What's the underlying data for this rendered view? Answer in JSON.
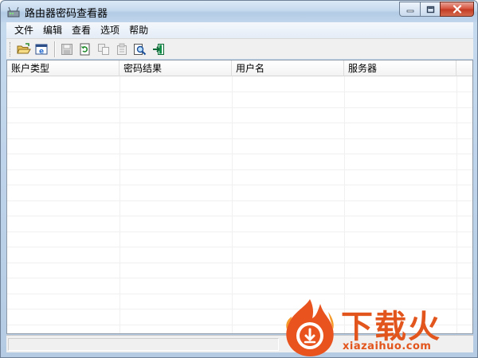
{
  "window": {
    "title": "路由器密码查看器",
    "controls": {
      "minimize_icon": "minimize-icon",
      "maximize_icon": "maximize-icon",
      "close_icon": "close-icon"
    }
  },
  "menu": {
    "items": [
      {
        "label": "文件"
      },
      {
        "label": "编辑"
      },
      {
        "label": "查看"
      },
      {
        "label": "选项"
      },
      {
        "label": "帮助"
      }
    ]
  },
  "toolbar": {
    "buttons": [
      {
        "icon": "open-folder-icon",
        "enabled": true
      },
      {
        "icon": "browser-icon",
        "enabled": true
      },
      {
        "icon": "save-icon",
        "enabled": false
      },
      {
        "icon": "refresh-icon",
        "enabled": true
      },
      {
        "icon": "copy-icon",
        "enabled": false
      },
      {
        "icon": "properties-icon",
        "enabled": false
      },
      {
        "icon": "find-icon",
        "enabled": true
      },
      {
        "icon": "exit-icon",
        "enabled": true
      }
    ]
  },
  "table": {
    "columns": [
      {
        "label": "账户类型"
      },
      {
        "label": "密码结果"
      },
      {
        "label": "用户名"
      },
      {
        "label": "服务器"
      }
    ],
    "rows": []
  },
  "watermark": {
    "brand": "下载火",
    "url": "xiazaihuo.com"
  },
  "colors": {
    "brand_orange": "#e2551c",
    "close_red": "#c23a22",
    "frame_blue": "#b4cbe3"
  }
}
